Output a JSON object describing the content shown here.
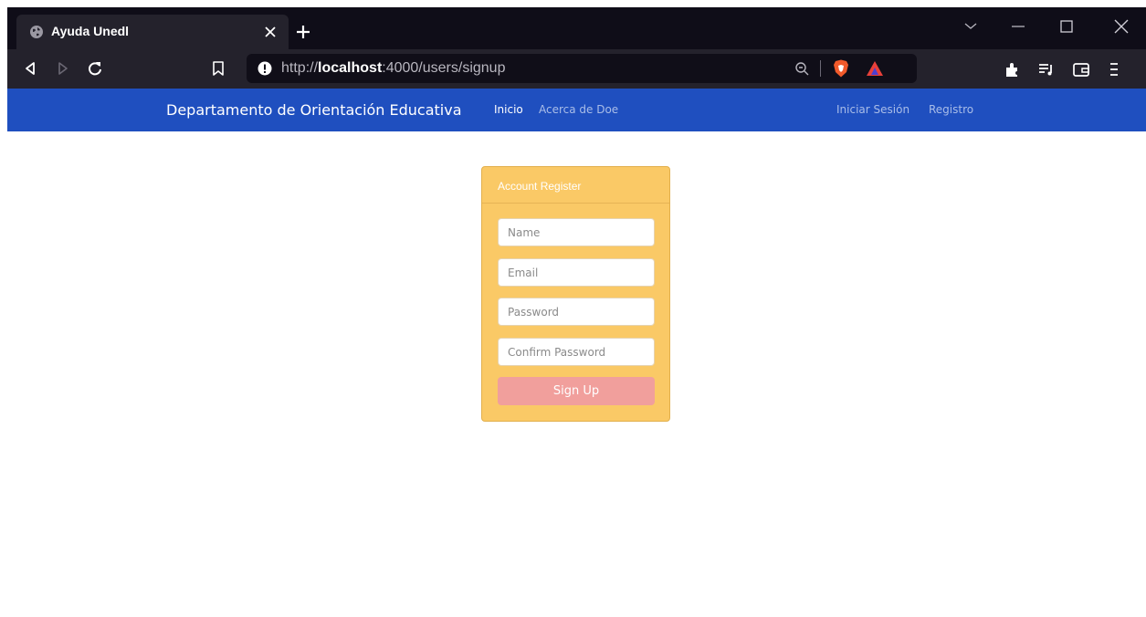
{
  "browser": {
    "tab": {
      "title": "Ayuda Unedl",
      "favicon": "globe-icon"
    },
    "url": {
      "scheme": "http://",
      "host": "localhost",
      "rest": ":4000/users/signup"
    },
    "icons": {
      "back": "back-icon",
      "forward": "forward-icon",
      "reload": "reload-icon",
      "bookmark": "bookmark-icon",
      "site_info": "info-icon",
      "zoom": "zoom-icon",
      "shields": "brave-shield-icon",
      "rewards": "brave-rewards-icon",
      "extensions": "extensions-icon",
      "playlist": "playlist-icon",
      "wallet": "wallet-icon",
      "menu": "menu-icon"
    }
  },
  "navbar": {
    "brand": "Departamento de Orientación Educativa",
    "links": [
      "Inicio",
      "Acerca de Doe"
    ],
    "auth_links": [
      "Iniciar Sesión",
      "Registro"
    ],
    "background": "#1f4fbf"
  },
  "form": {
    "header": "Account Register",
    "fields": [
      {
        "placeholder": "Name",
        "value": ""
      },
      {
        "placeholder": "Email",
        "value": ""
      },
      {
        "placeholder": "Password",
        "value": ""
      },
      {
        "placeholder": "Confirm Password",
        "value": ""
      }
    ],
    "submit_label": "Sign Up",
    "card_color": "#fac966",
    "button_color": "#f19f9c"
  }
}
